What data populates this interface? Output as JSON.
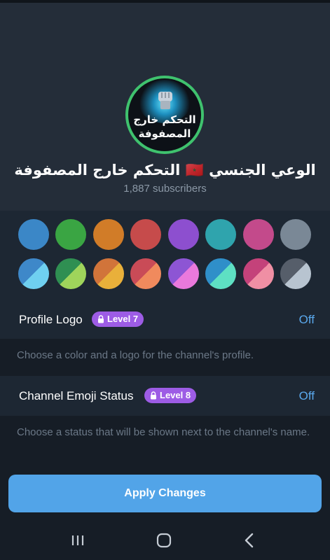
{
  "channel": {
    "avatar_line1": "التحكم خارج",
    "avatar_line2": "المصفوفة",
    "name": "الوعي الجنسي 🇲🇦 التحكم خارج المصفوفة",
    "subscribers": "1,887 subscribers"
  },
  "colors": {
    "solid": [
      "#3b87c7",
      "#3aa543",
      "#d17c28",
      "#c64b4b",
      "#8d4fcf",
      "#2fa4ad",
      "#c34a8b",
      "#7a8896"
    ],
    "dual": [
      [
        "#3e88c9",
        "#6fd0f0"
      ],
      [
        "#2f8f52",
        "#9fd45b"
      ],
      [
        "#d1743a",
        "#e9b03a"
      ],
      [
        "#c94b57",
        "#f08a5d"
      ],
      [
        "#8d55d4",
        "#ea79dc"
      ],
      [
        "#2f8fc9",
        "#5ee0c3"
      ],
      [
        "#c4427a",
        "#f08fa4"
      ],
      [
        "#565e6a",
        "#b8c4d0"
      ]
    ]
  },
  "profile_logo": {
    "label": "Profile Logo",
    "badge": "Level 7",
    "value": "Off",
    "description": "Choose a color and a logo for the channel's profile."
  },
  "emoji_status": {
    "label": "Channel Emoji Status",
    "badge": "Level 8",
    "value": "Off",
    "description": "Choose a status that will be shown next to the channel's name."
  },
  "apply_button": "Apply Changes",
  "navbar": {
    "icons": [
      "recent-apps-icon",
      "home-icon",
      "back-icon"
    ]
  },
  "accent_color": "#52a4e8",
  "badge_color": "#9d5ce5"
}
